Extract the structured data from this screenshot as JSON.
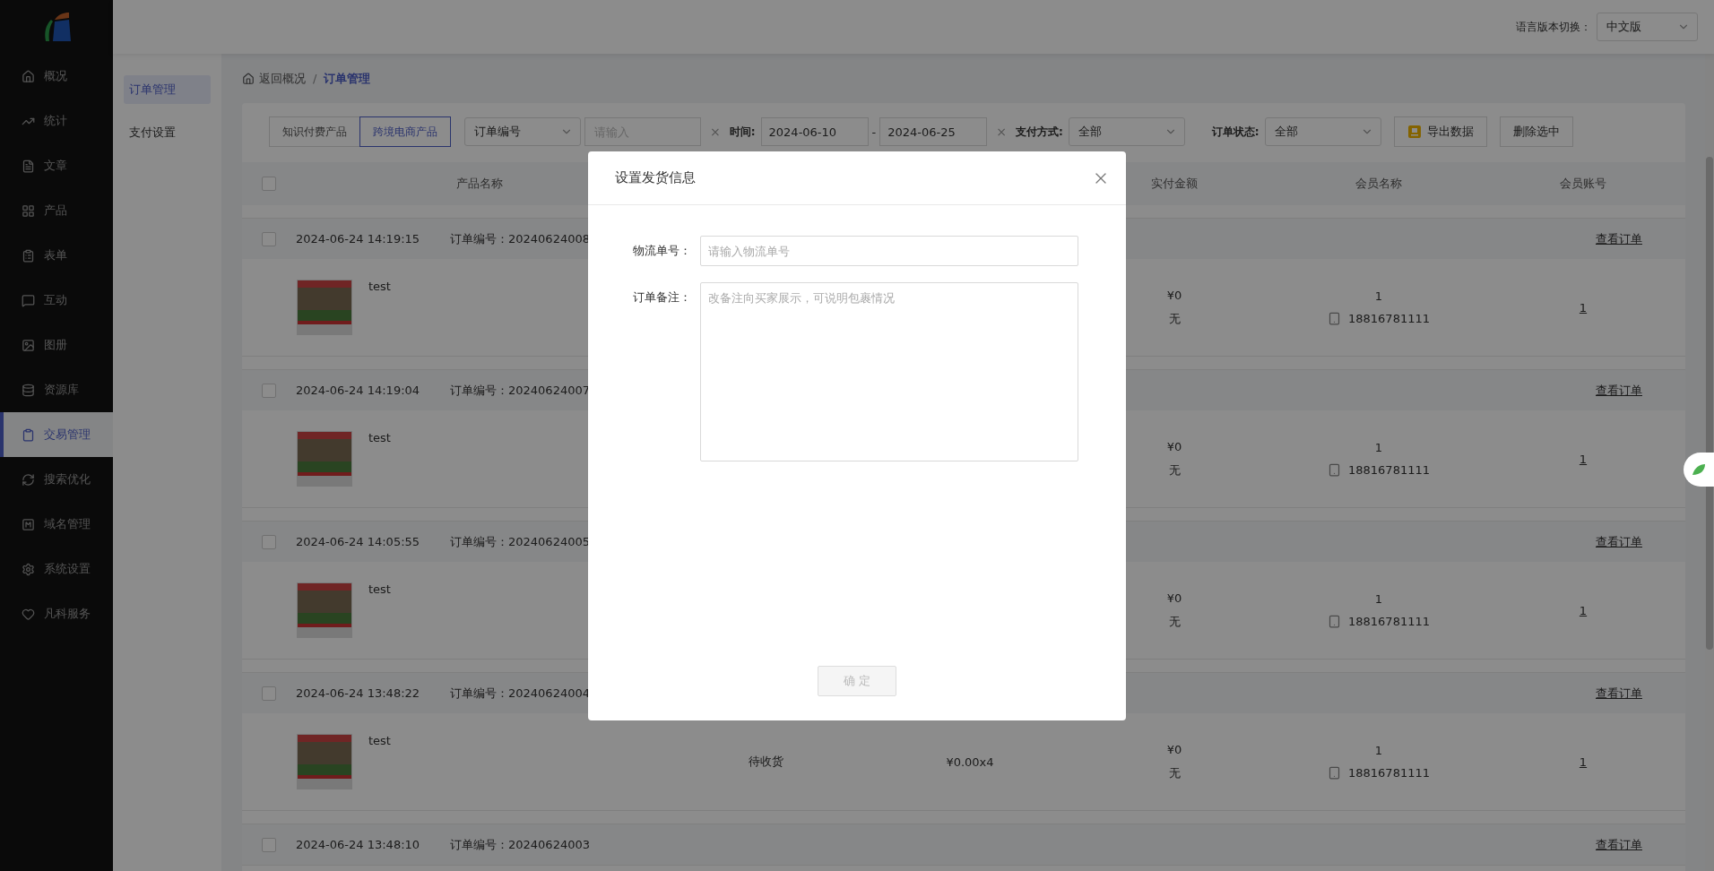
{
  "sidebar": {
    "items": [
      {
        "label": "概况",
        "selected": false
      },
      {
        "label": "统计",
        "selected": false
      },
      {
        "label": "文章",
        "selected": false
      },
      {
        "label": "产品",
        "selected": false
      },
      {
        "label": "表单",
        "selected": false
      },
      {
        "label": "互动",
        "selected": false
      },
      {
        "label": "图册",
        "selected": false
      },
      {
        "label": "资源库",
        "selected": false
      },
      {
        "label": "交易管理",
        "selected": true
      },
      {
        "label": "搜索优化",
        "selected": false
      },
      {
        "label": "域名管理",
        "selected": false
      },
      {
        "label": "系统设置",
        "selected": false
      },
      {
        "label": "凡科服务",
        "selected": false
      }
    ]
  },
  "header": {
    "language_label": "语言版本切换：",
    "language": "中文版"
  },
  "subnav": [
    {
      "label": "订单管理",
      "selected": true
    },
    {
      "label": "支付设置",
      "selected": false
    }
  ],
  "breadcrumb": {
    "back": "返回概况",
    "separator": "/",
    "current": "订单管理"
  },
  "filters": {
    "product_tabs": [
      {
        "label": "知识付费产品",
        "selected": false
      },
      {
        "label": "跨境电商产品",
        "selected": true
      }
    ],
    "search_field": "订单编号",
    "search": {
      "placeholder": "请输入"
    },
    "search_clear": "×",
    "time_label": "时间:",
    "date_from": "2024-06-10",
    "date_separator": "-",
    "date_to": "2024-06-25",
    "date_clear": "×",
    "payment_label": "支付方式:",
    "payment": "全部",
    "status_label": "订单状态:",
    "status": "全部",
    "export_button": "导出数据",
    "delete_button": "删除选中"
  },
  "table": {
    "select_all": {
      "checked": false
    },
    "columns": [
      "产品名称",
      "实付金额",
      "会员名称",
      "会员账号"
    ],
    "rows": [
      {
        "checked": false,
        "date": "2024-06-24 14:19:15",
        "order_no": "订单编号：20240624008",
        "view": "查看订单",
        "product": "test",
        "paid": "¥0",
        "paid_note": "无",
        "member": "1",
        "phone": "18816781111",
        "account": "1"
      },
      {
        "checked": false,
        "date": "2024-06-24 14:19:04",
        "order_no": "订单编号：20240624007",
        "view": "查看订单",
        "product": "test",
        "paid": "¥0",
        "paid_note": "无",
        "member": "1",
        "phone": "18816781111",
        "account": "1"
      },
      {
        "checked": false,
        "date": "2024-06-24 14:05:55",
        "order_no": "订单编号：20240624005",
        "view": "查看订单",
        "product": "test",
        "paid": "¥0",
        "paid_note": "无",
        "member": "1",
        "phone": "18816781111",
        "account": "1"
      },
      {
        "checked": false,
        "date": "2024-06-24 13:48:22",
        "order_no": "订单编号：20240624004",
        "view": "查看订单",
        "product": "test",
        "status": "待收货",
        "price": "¥0.00x4",
        "paid": "¥0",
        "paid_note": "无",
        "member": "1",
        "phone": "18816781111",
        "account": "1"
      },
      {
        "checked": false,
        "date": "2024-06-24 13:48:10",
        "order_no": "订单编号：20240624003",
        "view": "查看订单"
      }
    ]
  },
  "modal": {
    "title": "设置发货信息",
    "fields": [
      {
        "kind": "input",
        "label": "物流单号：",
        "placeholder": "请输入物流单号"
      },
      {
        "kind": "textarea",
        "label": "订单备注：",
        "placeholder": "改备注向买家展示，可说明包裹情况"
      }
    ],
    "confirm": {
      "label": "确 定",
      "disabled": true
    }
  }
}
